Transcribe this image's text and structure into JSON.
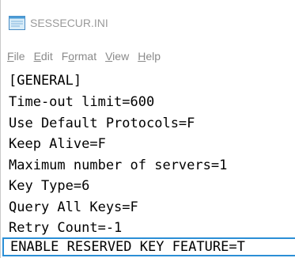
{
  "window": {
    "title": "SESSECUR.INI"
  },
  "menu": {
    "items": [
      {
        "pre": "",
        "mnemonic": "F",
        "post": "ile"
      },
      {
        "pre": "",
        "mnemonic": "E",
        "post": "dit"
      },
      {
        "pre": "F",
        "mnemonic": "o",
        "post": "rmat"
      },
      {
        "pre": "",
        "mnemonic": "V",
        "post": "iew"
      },
      {
        "pre": "",
        "mnemonic": "H",
        "post": "elp"
      }
    ]
  },
  "editor": {
    "lines": [
      "[GENERAL]",
      "Time-out limit=600",
      "Use Default Protocols=F",
      "Keep Alive=F",
      "Maximum number of servers=1",
      "Key Type=6",
      "Query All Keys=F",
      "Retry Count=-1",
      "ENABLE RESERVED KEY FEATURE=T"
    ],
    "highlighted_line_index": 8
  },
  "colors": {
    "highlight_border": "#2b8fd6",
    "menu_text": "#8a8a8a",
    "title_text": "#9a9a9a"
  },
  "icons": {
    "app": "notepad-icon"
  }
}
